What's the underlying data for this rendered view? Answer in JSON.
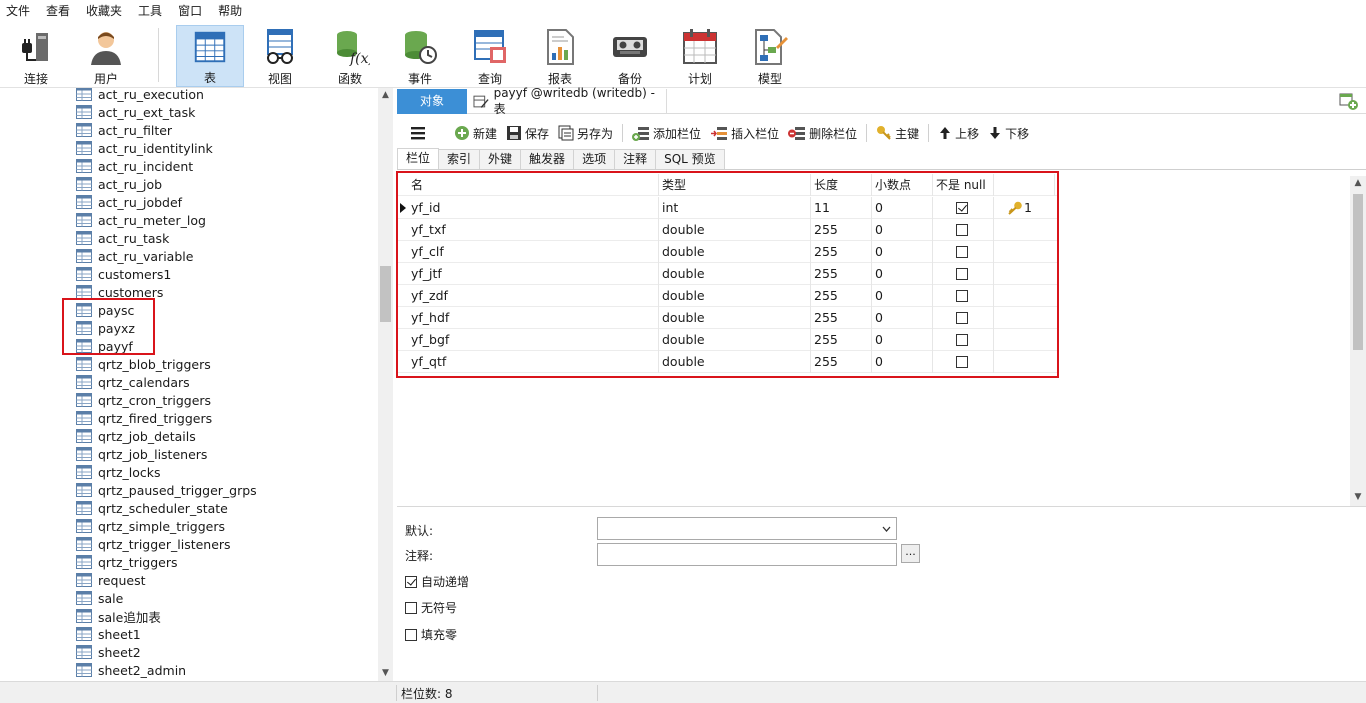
{
  "menu": [
    "文件",
    "查看",
    "收藏夹",
    "工具",
    "窗口",
    "帮助"
  ],
  "toolbar": {
    "buttons": [
      {
        "label": "连接",
        "icon": "connection-icon"
      },
      {
        "label": "用户",
        "icon": "user-icon"
      },
      {
        "label": "表",
        "icon": "table-icon",
        "active": true
      },
      {
        "label": "视图",
        "icon": "view-icon"
      },
      {
        "label": "函数",
        "icon": "function-icon"
      },
      {
        "label": "事件",
        "icon": "event-icon"
      },
      {
        "label": "查询",
        "icon": "query-icon"
      },
      {
        "label": "报表",
        "icon": "report-icon"
      },
      {
        "label": "备份",
        "icon": "backup-icon"
      },
      {
        "label": "计划",
        "icon": "schedule-icon"
      },
      {
        "label": "模型",
        "icon": "model-icon"
      }
    ]
  },
  "tree": {
    "tables": [
      "act_ru_execution",
      "act_ru_ext_task",
      "act_ru_filter",
      "act_ru_identitylink",
      "act_ru_incident",
      "act_ru_job",
      "act_ru_jobdef",
      "act_ru_meter_log",
      "act_ru_task",
      "act_ru_variable",
      "customers1",
      "customers",
      "paysc",
      "payxz",
      "payyf",
      "qrtz_blob_triggers",
      "qrtz_calendars",
      "qrtz_cron_triggers",
      "qrtz_fired_triggers",
      "qrtz_job_details",
      "qrtz_job_listeners",
      "qrtz_locks",
      "qrtz_paused_trigger_grps",
      "qrtz_scheduler_state",
      "qrtz_simple_triggers",
      "qrtz_trigger_listeners",
      "qrtz_triggers",
      "request",
      "sale",
      "sale追加表",
      "sheet1",
      "sheet2",
      "sheet2_admin"
    ]
  },
  "tabs": {
    "objects_label": "对象",
    "doc_title": "payyf @writedb (writedb) - 表"
  },
  "actions": {
    "new": "新建",
    "save": "保存",
    "save_as": "另存为",
    "add_field": "添加栏位",
    "insert_field": "插入栏位",
    "delete_field": "删除栏位",
    "primary_key": "主键",
    "move_up": "上移",
    "move_down": "下移"
  },
  "subtabs": [
    "栏位",
    "索引",
    "外键",
    "触发器",
    "选项",
    "注释",
    "SQL 预览"
  ],
  "grid": {
    "headers": {
      "name": "名",
      "type": "类型",
      "length": "长度",
      "decimals": "小数点",
      "not_null": "不是 null"
    },
    "rows": [
      {
        "name": "yf_id",
        "type": "int",
        "length": "11",
        "decimals": "0",
        "not_null": true,
        "key": "1"
      },
      {
        "name": "yf_txf",
        "type": "double",
        "length": "255",
        "decimals": "0",
        "not_null": false,
        "key": ""
      },
      {
        "name": "yf_clf",
        "type": "double",
        "length": "255",
        "decimals": "0",
        "not_null": false,
        "key": ""
      },
      {
        "name": "yf_jtf",
        "type": "double",
        "length": "255",
        "decimals": "0",
        "not_null": false,
        "key": ""
      },
      {
        "name": "yf_zdf",
        "type": "double",
        "length": "255",
        "decimals": "0",
        "not_null": false,
        "key": ""
      },
      {
        "name": "yf_hdf",
        "type": "double",
        "length": "255",
        "decimals": "0",
        "not_null": false,
        "key": ""
      },
      {
        "name": "yf_bgf",
        "type": "double",
        "length": "255",
        "decimals": "0",
        "not_null": false,
        "key": ""
      },
      {
        "name": "yf_qtf",
        "type": "double",
        "length": "255",
        "decimals": "0",
        "not_null": false,
        "key": ""
      }
    ]
  },
  "props": {
    "default_label": "默认:",
    "default_value": "",
    "comment_label": "注释:",
    "comment_value": "",
    "ellipsis": "...",
    "auto_increment": {
      "label": "自动递增",
      "checked": true
    },
    "unsigned": {
      "label": "无符号",
      "checked": false
    },
    "zerofill": {
      "label": "填充零",
      "checked": false
    }
  },
  "status": {
    "field_count": "栏位数: 8"
  },
  "colors": {
    "accent": "#3c8fd6",
    "highlight_box": "#d9141b",
    "active_tool": "#cde3f7"
  }
}
